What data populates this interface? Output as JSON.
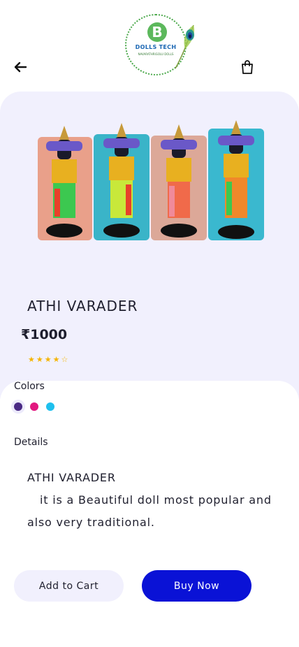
{
  "header": {
    "logo": {
      "brand": "DOLLS TECH",
      "tagline": "NAVARATHRIGOLU DOLLS",
      "initial": "B"
    }
  },
  "product": {
    "name": "ATHI VARADER",
    "price": "₹1000",
    "rating": {
      "value": 4,
      "max": 5
    }
  },
  "colors": {
    "label": "Colors",
    "options": [
      "#4a2a85",
      "#e2187f",
      "#1ec0ee"
    ],
    "selected_index": 0
  },
  "details": {
    "label": "Details",
    "title": "ATHI VARADER",
    "body": "it is a Beautiful doll most popular and also very traditional."
  },
  "actions": {
    "add_to_cart": "Add to Cart",
    "buy_now": "Buy Now"
  },
  "theme": {
    "panel_bg": "#f1f0fd",
    "primary": "#0a12d6",
    "star": "#f5b400"
  }
}
